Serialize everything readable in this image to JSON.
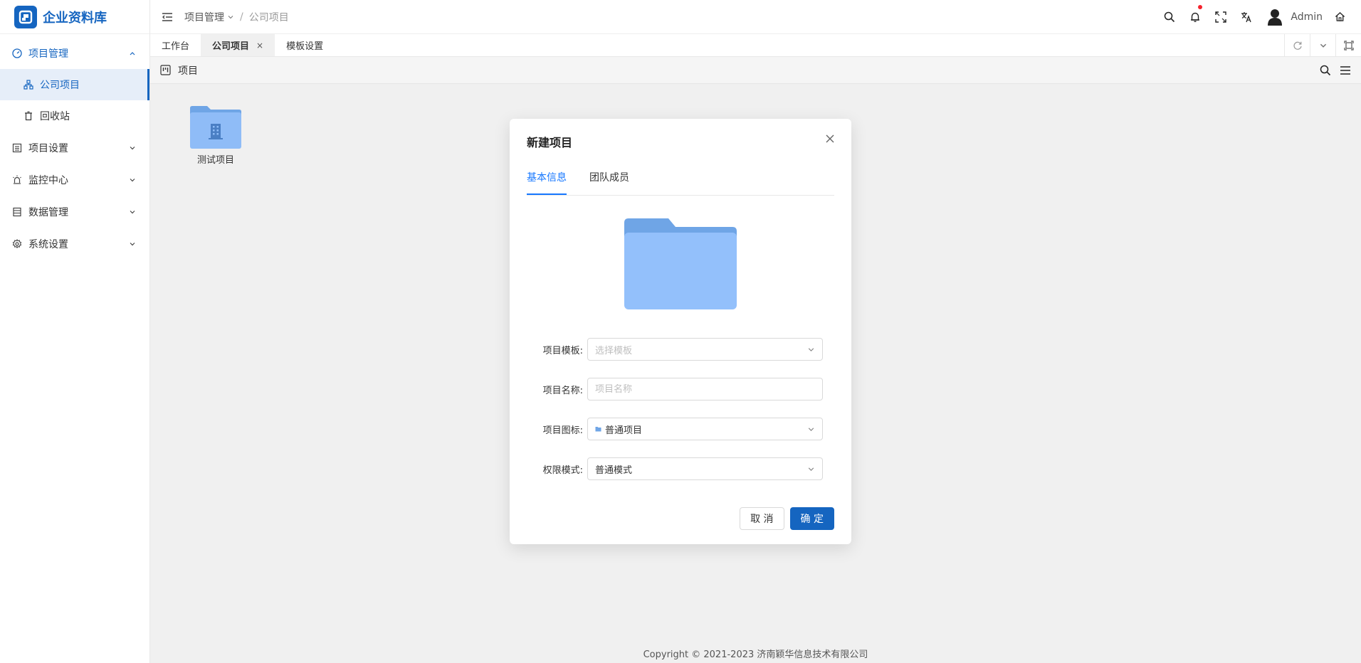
{
  "app": {
    "title": "企业资料库"
  },
  "colors": {
    "primary": "#1565c0",
    "tab_active": "#1677ff",
    "content_bg": "#f0f0f0",
    "folder": "#8fbcf7",
    "folder_back": "#6fa5e6"
  },
  "sidebar": {
    "items": [
      {
        "label": "项目管理",
        "icon": "dashboard-icon",
        "expanded": true,
        "children": [
          {
            "label": "公司项目",
            "icon": "org-chart-icon",
            "active": true
          },
          {
            "label": "回收站",
            "icon": "trash-icon"
          }
        ]
      },
      {
        "label": "项目设置",
        "icon": "list-icon"
      },
      {
        "label": "监控中心",
        "icon": "alarm-icon"
      },
      {
        "label": "数据管理",
        "icon": "database-icon"
      },
      {
        "label": "系统设置",
        "icon": "gear-icon"
      }
    ]
  },
  "header": {
    "breadcrumb": {
      "parent": "项目管理",
      "current": "公司项目"
    },
    "user": "Admin"
  },
  "tabs": [
    {
      "label": "工作台"
    },
    {
      "label": "公司项目",
      "active": true,
      "close": "×"
    },
    {
      "label": "模板设置"
    }
  ],
  "page": {
    "title": "项目"
  },
  "projects": [
    {
      "name": "测试项目"
    }
  ],
  "footer": {
    "copyright": "Copyright © 2021-2023 济南颖华信息技术有限公司"
  },
  "modal": {
    "title": "新建项目",
    "tabs": [
      {
        "label": "基本信息",
        "active": true
      },
      {
        "label": "团队成员"
      }
    ],
    "form": {
      "template": {
        "label": "项目模板:",
        "placeholder": "选择模板"
      },
      "name": {
        "label": "项目名称:",
        "placeholder": "项目名称"
      },
      "icon": {
        "label": "项目图标:",
        "value": "普通项目"
      },
      "permission": {
        "label": "权限模式:",
        "value": "普通模式"
      }
    },
    "cancel": "取 消",
    "ok": "确 定"
  }
}
